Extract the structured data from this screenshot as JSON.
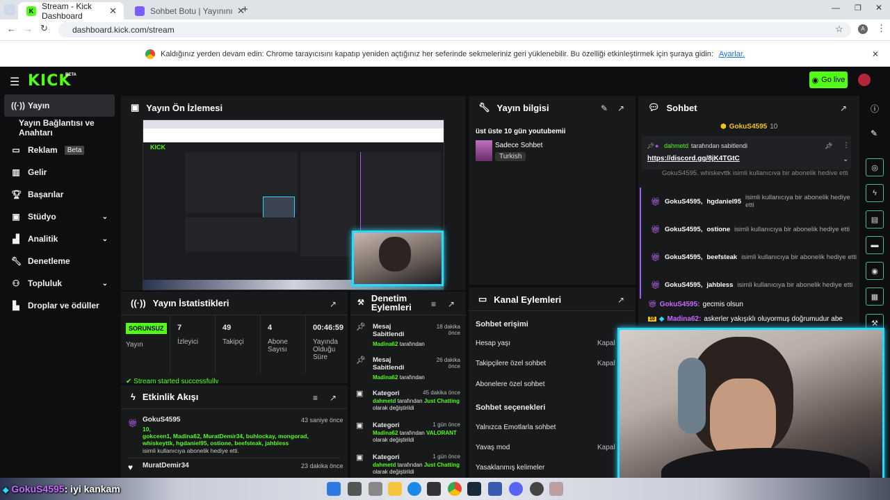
{
  "browser": {
    "tabs": [
      {
        "label": "Stream - Kick Dashboard"
      },
      {
        "label": "Sohbet Botu | Yayınını güçlend"
      }
    ],
    "url": "dashboard.kick.com/stream",
    "infobar": {
      "text": "Kaldığınız yerden devam edin: Chrome tarayıcısını kapatıp yeniden açtığınız her seferinde sekmeleriniz geri yüklenebilir. Bu özelliği etkinleştirmek için şuraya gidin:",
      "link": "Ayarlar."
    }
  },
  "header": {
    "logo": "KICK",
    "logo_sup": "BETA",
    "go_live": "Go live"
  },
  "sidebar": {
    "items": [
      {
        "label": "Yayın",
        "icon": "broadcast-icon"
      },
      {
        "label": "Yayın Bağlantısı ve Anahtarı",
        "icon": ""
      },
      {
        "label": "Reklam",
        "icon": "ad-icon",
        "badge": "Beta"
      },
      {
        "label": "Gelir",
        "icon": "chart-icon"
      },
      {
        "label": "Başarılar",
        "icon": "trophy-icon"
      },
      {
        "label": "Stüdyo",
        "icon": "studio-icon"
      },
      {
        "label": "Analitik",
        "icon": "analytics-icon"
      },
      {
        "label": "Denetleme",
        "icon": "wrench-icon"
      },
      {
        "label": "Topluluk",
        "icon": "community-icon"
      },
      {
        "label": "Droplar ve ödüller",
        "icon": "drops-icon"
      }
    ]
  },
  "preview": {
    "title": "Yayın Ön İzlemesi"
  },
  "stats": {
    "title": "Yayın İstatistikleri",
    "status": "SORUNSUZ",
    "status_label": "Yayın",
    "viewers": "7",
    "viewers_label": "İzleyici",
    "followers": "49",
    "followers_label": "Takipçi",
    "subs": "4",
    "subs_label": "Abone Sayısı",
    "uptime": "00:46:59",
    "uptime_label": "Yayında Olduğu Süre",
    "started": "Stream started successfully"
  },
  "activity": {
    "title": "Etkinlik Akışı",
    "items": [
      {
        "user": "GokuS4595",
        "time": "43 saniye önce",
        "detail": "10,\ngokceen1, Madina62, MuratDemir34, buhlockay, mongorad, whiskeyttk, hgdaniel95, ostione, beefsteak, jahbless",
        "suffix": "isimli kullanıcıya abonelik hediye etti."
      },
      {
        "user": "MuratDemir34",
        "time": "23 dakika önce"
      }
    ]
  },
  "mod": {
    "title": "Denetim Eylemleri",
    "items": [
      {
        "title": "Mesaj Sabitlendi",
        "time": "18 dakika önce",
        "user": "Madina62",
        "by": "tarafından",
        "extra": ""
      },
      {
        "title": "Mesaj Sabitlendi",
        "time": "26 dakika önce",
        "user": "Madina62",
        "by": "tarafından",
        "extra": ""
      },
      {
        "title": "Kategori",
        "time": "45 dakika önce",
        "user": "dahmetd",
        "by": "tarafından",
        "cat": "Just Chatting",
        "extra": "olarak değiştirildi"
      },
      {
        "title": "Kategori",
        "time": "1 gün önce",
        "user": "Madina62",
        "by": "tarafından",
        "cat": "VALORANT",
        "extra": "olarak değiştirildi"
      },
      {
        "title": "Kategori",
        "time": "1 gün önce",
        "user": "dahmetd",
        "by": "tarafından",
        "cat": "Just Chatting",
        "extra": "olarak değiştirildi"
      }
    ]
  },
  "info": {
    "title": "Yayın bilgisi",
    "stream_title": "üst üste 10 gün youtubemii",
    "category": "Sadece Sohbet",
    "language": "Turkish"
  },
  "channel": {
    "title": "Kanal Eylemleri",
    "section1": "Sohbet erişimi",
    "rows1": [
      {
        "label": "Hesap yaşı",
        "value": "Kapal"
      },
      {
        "label": "Takipçilere özel sohbet",
        "value": "Kapal"
      },
      {
        "label": "Abonelere özel sohbet",
        "value": ""
      }
    ],
    "section2": "Sohbet seçenekleri",
    "rows2": [
      {
        "label": "Yalnızca Emotlarla sohbet",
        "value": ""
      },
      {
        "label": "Yavaş mod",
        "value": "Kapal"
      },
      {
        "label": "Yasaklanmış kelimeler",
        "value": ""
      }
    ]
  },
  "chat": {
    "title": "Sohbet",
    "top_user": "GokuS4595",
    "top_count": "10",
    "pinned_by": "dahmetd",
    "pinned_suffix": "tarafından sabitlendi",
    "pinned_link": "https://discord.gg/8jK4TGtC",
    "cut_line": "GokuS4595, whiskeyttk isimli kullanıcıya bir abonelik hediye etti",
    "gifts": [
      {
        "user": "GokuS4595,",
        "target": "hgdaniel95",
        "suffix": "isimli kullanıcıya bir abonelik hediye etti"
      },
      {
        "user": "GokuS4595,",
        "target": "ostione",
        "suffix": "isimli kullanıcıya bir abonelik hediye etti"
      },
      {
        "user": "GokuS4595,",
        "target": "beefsteak",
        "suffix": "isimli kullanıcıya bir abonelik hediye etti"
      },
      {
        "user": "GokuS4595,",
        "target": "jahbless",
        "suffix": "isimli kullanıcıya bir abonelik hediye etti"
      }
    ],
    "msg1_user": "GokuS4595:",
    "msg1_text": "gecmis olsun",
    "msg2_badge": "10",
    "msg2_user": "Madina62:",
    "msg2_text": "askerler yakışıklı oluyormuş doğrumudur abe"
  },
  "overlay": {
    "user": "GokuS4595",
    "text": ": iyi kankam"
  },
  "colors": {
    "accent": "#53fc18",
    "cam_border": "#29d8ff",
    "sub_purple": "#a957f6"
  }
}
